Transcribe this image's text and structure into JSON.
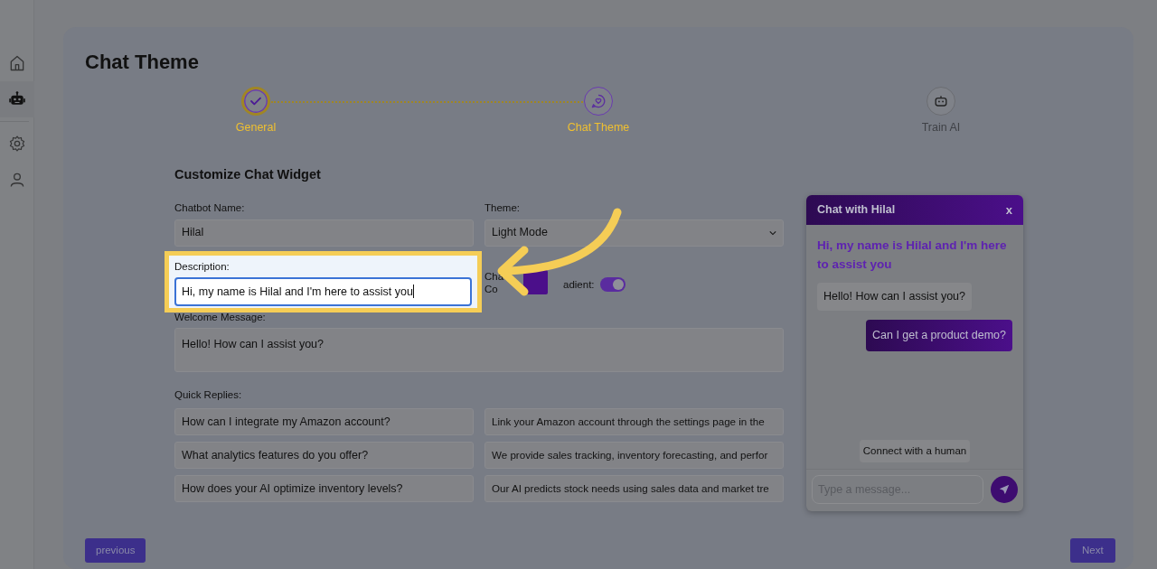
{
  "sidebar": {
    "items": [
      {
        "kind": "home",
        "selected": false
      },
      {
        "kind": "bot",
        "selected": true
      },
      {
        "kind": "settings",
        "selected": false
      },
      {
        "kind": "user",
        "selected": false
      }
    ]
  },
  "page_title": "Chat Theme",
  "stepper": {
    "steps": [
      {
        "label": "General",
        "kind": "check",
        "done": true,
        "current": false
      },
      {
        "label": "Chat Theme",
        "kind": "chat",
        "done": false,
        "current": true
      },
      {
        "label": "Train AI",
        "kind": "bot",
        "done": false,
        "current": false
      }
    ]
  },
  "form": {
    "heading": "Customize Chat Widget",
    "chatbot_name": {
      "label": "Chatbot Name:",
      "value": "Hilal"
    },
    "theme": {
      "label": "Theme:",
      "value": "Light Mode"
    },
    "description": {
      "label": "Description:",
      "value": "Hi, my name is Hilal and I'm here to assist you",
      "highlighted": true
    },
    "chat_color": {
      "label_lines": [
        "Cha",
        "Co"
      ],
      "color": "#4b0f8a"
    },
    "gradient": {
      "label": "adient:",
      "on": true
    },
    "welcome_message": {
      "label": "Welcome Message:",
      "value": "Hello! How can I assist you?"
    },
    "quick_replies": {
      "label": "Quick Replies:",
      "rows": [
        {
          "question": "How can I integrate my Amazon account?",
          "answer": "Link your Amazon account through the settings page in the"
        },
        {
          "question": "What analytics features do you offer?",
          "answer": "We provide sales tracking, inventory forecasting, and perfor"
        },
        {
          "question": "How does your AI optimize inventory levels?",
          "answer": "Our AI predicts stock needs using sales data and market tre"
        }
      ]
    }
  },
  "chat_widget": {
    "title": "Chat with Hilal",
    "close": "x",
    "intro": "Hi, my name is Hilal and I'm here to assist you",
    "messages": [
      {
        "from_user": false,
        "text": "Hello! How can I assist you?"
      },
      {
        "from_user": true,
        "text": "Can I get a product demo?"
      }
    ],
    "connect_button": "Connect with a human",
    "input": {
      "placeholder": "Type a message..."
    }
  },
  "buttons": {
    "previous": "previous",
    "next": "Next"
  }
}
